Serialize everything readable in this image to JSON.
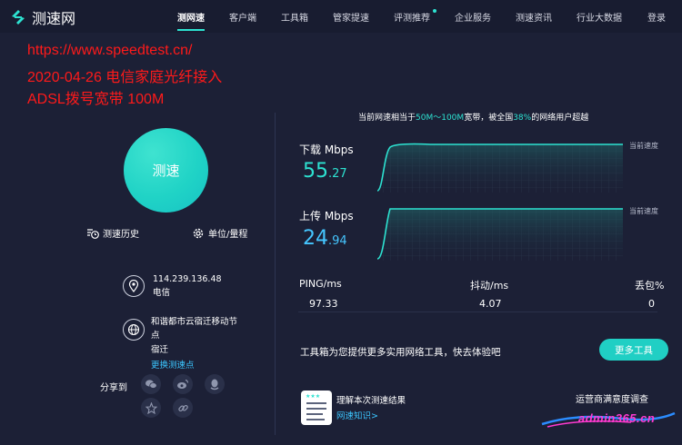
{
  "header": {
    "brand": "测速网",
    "nav": [
      {
        "label": "测网速",
        "active": true
      },
      {
        "label": "客户端"
      },
      {
        "label": "工具箱"
      },
      {
        "label": "管家提速"
      },
      {
        "label": "评测推荐"
      },
      {
        "label": "企业服务"
      },
      {
        "label": "测速资讯"
      },
      {
        "label": "行业大数据"
      },
      {
        "label": "登录"
      }
    ]
  },
  "overlay": {
    "line1": "https://www.speedtest.cn/",
    "line2": "2020-04-26 电信家庭光纤接入",
    "line3": "ADSL拨号宽带 100M"
  },
  "left": {
    "speed_button": "测速",
    "history": "测速历史",
    "units": "单位/量程",
    "ip": "114.239.136.48",
    "isp": "电信",
    "node_line1": "和谐都市云宿迁移动节",
    "node_line2": "点",
    "node_city": "宿迁",
    "change_node": "更换测速点",
    "share_label": "分享到"
  },
  "right": {
    "summary_pre": "当前网速相当于",
    "summary_range": "50M～100M",
    "summary_mid": "宽带，被全国",
    "summary_pct": "38%",
    "summary_post": "的网络用户超越",
    "download_label": "下载 Mbps",
    "download_int": "55",
    "download_dec": ".27",
    "upload_label": "上传 Mbps",
    "upload_int": "24",
    "upload_dec": ".94",
    "current_speed_tag": "当前速度",
    "ping_label": "PING/ms",
    "ping_value": "97.33",
    "jitter_label": "抖动/ms",
    "jitter_value": "4.07",
    "loss_label": "丢包%",
    "loss_value": "0",
    "tools_text": "工具箱为您提供更多实用网络工具，快去体验吧",
    "more_tools": "更多工具",
    "understand": "理解本次测速结果",
    "kb_link": "网速知识>",
    "survey": "运营商满意度调查"
  },
  "watermark": "admin365.cn",
  "colors": {
    "background": "#1c2036",
    "accent": "#2de2d1",
    "upload_accent": "#45c6ff",
    "link": "#3bc6ff",
    "overlay_red": "#ff1a1a"
  }
}
